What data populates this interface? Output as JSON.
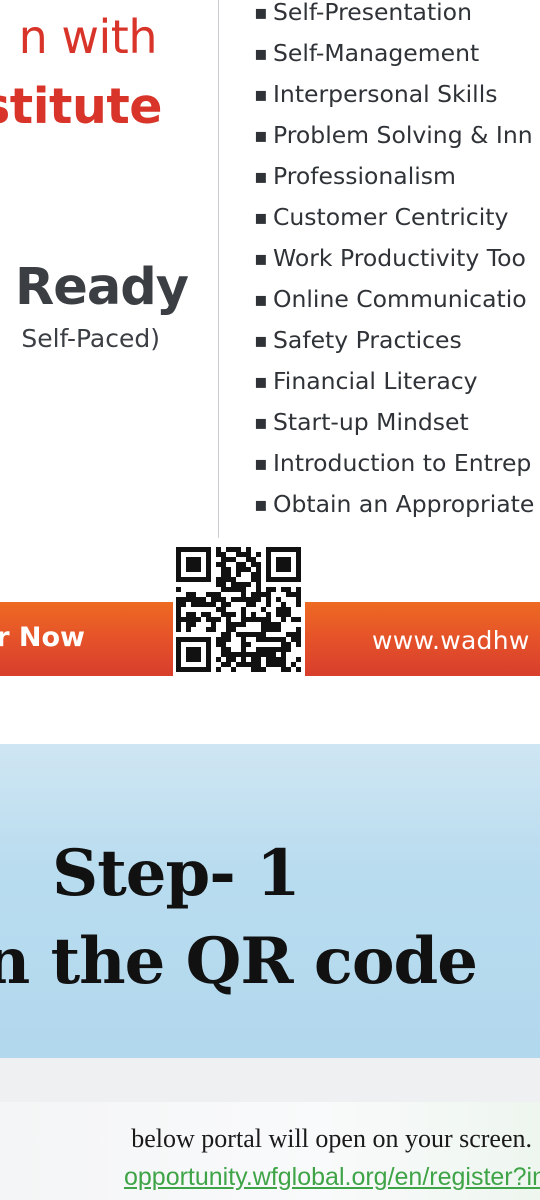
{
  "flyer": {
    "headline_line1": "n with",
    "headline_line2": "stitute",
    "course_title": "o Ready",
    "course_mode": "Self-Paced)",
    "skills": [
      "Self-Presentation",
      "Self-Management",
      "Interpersonal Skills",
      "Problem Solving & Inn",
      "Professionalism",
      "Customer Centricity",
      "Work Productivity Too",
      "Online Communicatio",
      "Safety Practices",
      "Financial Literacy",
      "Start-up Mindset",
      "Introduction to Entrep",
      "Obtain an Appropriate"
    ],
    "bullet": "▪",
    "register_label": "r Now",
    "website": "www.wadhw",
    "qr_icon": "qr-code",
    "colors": {
      "headline_red": "#d8342a",
      "band_orange": "#e4502a",
      "text_dark": "#3b3f44"
    }
  },
  "slide": {
    "step_title": "Step- 1",
    "step_description": "n the QR code",
    "background": "#b9dcef"
  },
  "note": {
    "instruction": "below portal will open on your screen.",
    "portal_url": "opportunity.wfglobal.org/en/register?in",
    "url_color": "#3fa447"
  }
}
